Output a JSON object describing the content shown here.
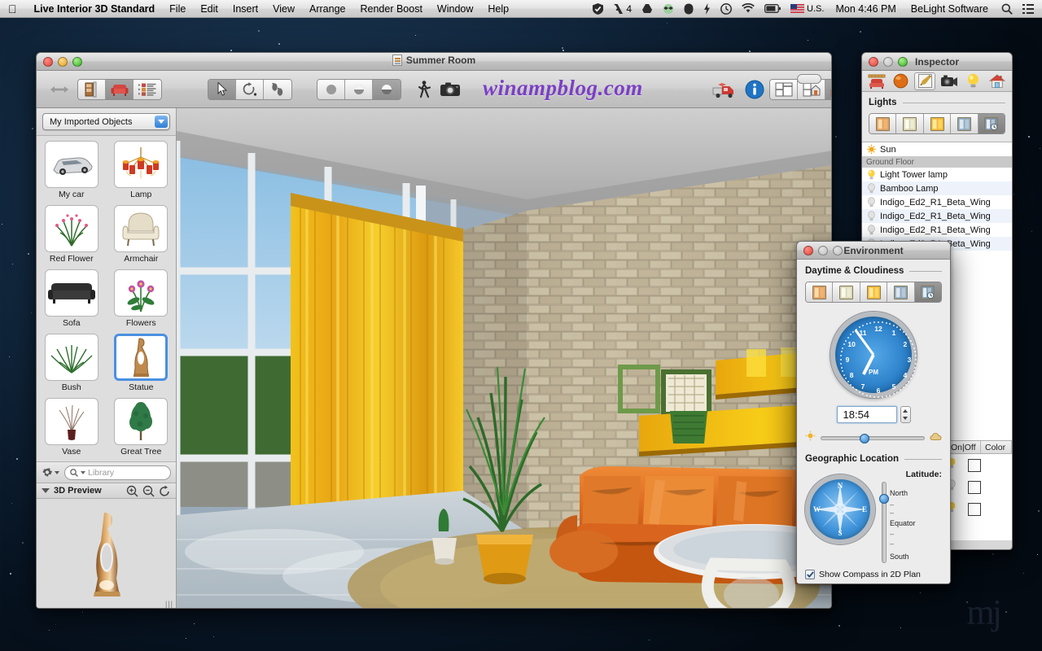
{
  "menubar": {
    "apple_icon": "apple-logo-icon",
    "app_name": "Live Interior 3D Standard",
    "menus": [
      "File",
      "Edit",
      "Insert",
      "View",
      "Arrange",
      "Render Boost",
      "Window",
      "Help"
    ],
    "status_icons": [
      "checkmark-shield-icon",
      "adobe-icon",
      "google-drive-icon",
      "dropbox-icon",
      "evernote-icon",
      "flash-icon",
      "time-machine-icon",
      "wifi-icon",
      "battery-icon",
      "us-flag-icon"
    ],
    "badge_number": "4",
    "input_locale": "U.S.",
    "clock": "Mon 4:46 PM",
    "user": "BeLight Software",
    "search_icon": "search-icon",
    "notification_icon": "notification-center-icon"
  },
  "main_window": {
    "title": "Summer Room",
    "document_icon": "document-icon",
    "watermark": "winampblog.com",
    "toolbar": {
      "resize_icon": "resize-handle-icon",
      "left_group": [
        {
          "name": "library-objects-button",
          "icon": "bookshelf-icon",
          "active": false
        },
        {
          "name": "library-furniture-button",
          "icon": "armchair-icon",
          "active": true
        },
        {
          "name": "library-list-button",
          "icon": "list-view-icon",
          "active": false
        }
      ],
      "tool_group": [
        {
          "name": "select-tool",
          "icon": "arrow-cursor-icon",
          "active": true
        },
        {
          "name": "rotate-tool",
          "icon": "rotate-icon",
          "active": false
        },
        {
          "name": "walk-tool",
          "icon": "footsteps-icon",
          "active": false
        }
      ],
      "render_group": [
        {
          "name": "render-flat-button",
          "icon": "sphere-flat-icon",
          "active": false
        },
        {
          "name": "render-shaded-button",
          "icon": "sphere-shaded-icon",
          "active": false
        },
        {
          "name": "render-realistic-button",
          "icon": "sphere-realistic-icon",
          "active": true
        }
      ],
      "walkthrough_button": {
        "name": "walkthrough-button",
        "icon": "walking-person-icon"
      },
      "camera_button": {
        "name": "camera-button",
        "icon": "camera-icon"
      },
      "truck_button": {
        "name": "move-object-button",
        "icon": "red-truck-icon"
      },
      "info_button": {
        "name": "info-button",
        "icon": "info-circle-icon"
      },
      "view_group": [
        {
          "name": "view-2d-plan-button",
          "icon": "floorplan-icon",
          "active": false
        },
        {
          "name": "view-split-button",
          "icon": "split-view-icon",
          "active": false
        },
        {
          "name": "view-3d-button",
          "icon": "house-3d-icon",
          "active": true
        }
      ]
    }
  },
  "sidebar": {
    "collection_popup": {
      "value": "My Imported Objects",
      "chevron_icon": "chevron-down-icon"
    },
    "objects": [
      {
        "label": "My car",
        "icon": "car-icon",
        "selected": false
      },
      {
        "label": "Lamp",
        "icon": "chandelier-icon",
        "selected": false
      },
      {
        "label": "Red Flower",
        "icon": "flower-plant-icon",
        "selected": false
      },
      {
        "label": "Armchair",
        "icon": "armchair-icon",
        "selected": false
      },
      {
        "label": "Sofa",
        "icon": "sofa-icon",
        "selected": false
      },
      {
        "label": "Flowers",
        "icon": "flowers-icon",
        "selected": false
      },
      {
        "label": "Bush",
        "icon": "bush-icon",
        "selected": false
      },
      {
        "label": "Statue",
        "icon": "statue-icon",
        "selected": true
      },
      {
        "label": "Vase",
        "icon": "vase-icon",
        "selected": false
      },
      {
        "label": "Great Tree",
        "icon": "tree-icon",
        "selected": false
      }
    ],
    "gear_icon": "gear-icon",
    "search": {
      "icon": "search-icon",
      "placeholder": "Library",
      "value": ""
    },
    "preview": {
      "disclosure_icon": "disclosure-triangle-icon",
      "title": "3D Preview",
      "zoom_in_icon": "zoom-in-icon",
      "zoom_out_icon": "zoom-out-icon",
      "rotate_icon": "rotate-refresh-icon",
      "object_icon": "statue-3d-icon",
      "resize_grip": "resize-grip-icon"
    }
  },
  "inspector": {
    "title": "Inspector",
    "tabs": [
      {
        "name": "tab-object",
        "icon": "furniture-ruler-icon",
        "active": false
      },
      {
        "name": "tab-material",
        "icon": "orange-sphere-icon",
        "active": false
      },
      {
        "name": "tab-edit",
        "icon": "pencil-note-icon",
        "active": true
      },
      {
        "name": "tab-camera",
        "icon": "camera-icon",
        "active": false
      },
      {
        "name": "tab-lights",
        "icon": "light-bulb-icon",
        "active": false
      },
      {
        "name": "tab-site",
        "icon": "house-icon",
        "active": false
      }
    ],
    "lights_section": {
      "title": "Lights",
      "modes": [
        {
          "name": "light-mode-warm",
          "icon": "warm-window-icon",
          "active": false
        },
        {
          "name": "light-mode-neutral",
          "icon": "neutral-window-icon",
          "active": false
        },
        {
          "name": "light-mode-bright",
          "icon": "bright-window-icon",
          "active": false
        },
        {
          "name": "light-mode-cool",
          "icon": "cool-window-icon",
          "active": false
        },
        {
          "name": "light-mode-scheduled",
          "icon": "window-clock-icon",
          "active": true
        }
      ]
    },
    "lights": [
      {
        "label": "Sun",
        "icon": "sun-icon",
        "type": "item"
      },
      {
        "label": "Ground Floor",
        "icon": "",
        "type": "group"
      },
      {
        "label": "Light Tower lamp",
        "icon": "bulb-on-icon",
        "type": "item"
      },
      {
        "label": "Bamboo Lamp",
        "icon": "bulb-off-icon",
        "type": "item"
      },
      {
        "label": "Indigo_Ed2_R1_Beta_Wing",
        "icon": "bulb-off-icon",
        "type": "item"
      },
      {
        "label": "Indigo_Ed2_R1_Beta_Wing",
        "icon": "bulb-off-icon",
        "type": "item"
      },
      {
        "label": "Indigo_Ed2_R1_Beta_Wing",
        "icon": "bulb-off-icon",
        "type": "item"
      },
      {
        "label": "Indigo_Ed2_R1_Beta_Wing",
        "icon": "bulb-off-icon",
        "type": "item"
      }
    ],
    "table_columns": [
      "On|Off",
      "Color"
    ],
    "table_rows": [
      {
        "state": "bulb-on-icon",
        "color": "#ffffff"
      },
      {
        "state": "bulb-off-icon",
        "color": "#ffffff"
      },
      {
        "state": "bulb-on-icon",
        "color": "#ffffff"
      }
    ]
  },
  "environment": {
    "title": "Environment",
    "daytime_section": {
      "title": "Daytime & Cloudiness",
      "modes": [
        {
          "name": "daytime-mode-sunrise",
          "icon": "warm-window-icon",
          "active": false
        },
        {
          "name": "daytime-mode-day",
          "icon": "neutral-window-icon",
          "active": false
        },
        {
          "name": "daytime-mode-sunset",
          "icon": "bright-window-icon",
          "active": false
        },
        {
          "name": "daytime-mode-night",
          "icon": "cool-window-icon",
          "active": false
        },
        {
          "name": "daytime-mode-custom",
          "icon": "window-clock-icon",
          "active": true
        }
      ]
    },
    "clock": {
      "name": "analog-clock",
      "hours": [
        "12",
        "1",
        "2",
        "3",
        "4",
        "5",
        "6",
        "7",
        "8",
        "9",
        "10",
        "11"
      ],
      "meridiem": "PM",
      "hour_angle": 207,
      "minute_angle": 324
    },
    "time_field": {
      "value": "18:54",
      "stepper_icon": "stepper-icon"
    },
    "cloudiness_slider": {
      "sun_icon": "sun-small-icon",
      "cloud_icon": "cloud-small-icon",
      "value_pct": 42
    },
    "geo_section": {
      "title": "Geographic Location",
      "compass_icon": "compass-rose-icon",
      "compass_letters": [
        "N",
        "E",
        "S",
        "W"
      ],
      "latitude_label": "Latitude:",
      "latitude_ticks": [
        "North",
        "Equator",
        "South"
      ],
      "latitude_value_pct": 20
    },
    "show_compass": {
      "label": "Show Compass in 2D Plan",
      "checked": true,
      "check_icon": "checkmark-icon"
    }
  },
  "desktop": {
    "watermark": "mj"
  }
}
